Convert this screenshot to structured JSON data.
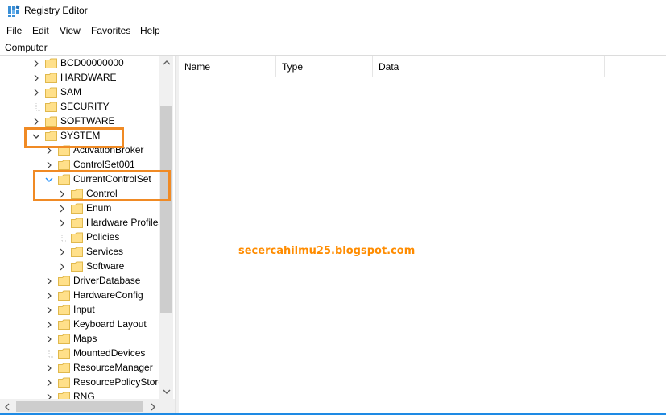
{
  "window": {
    "title": "Registry Editor"
  },
  "menu": [
    "File",
    "Edit",
    "View",
    "Favorites",
    "Help"
  ],
  "address": "Computer",
  "columns": [
    "Name",
    "Type",
    "Data"
  ],
  "tree": [
    {
      "label": "BCD00000000",
      "expander": "collapsed"
    },
    {
      "label": "HARDWARE",
      "expander": "collapsed"
    },
    {
      "label": "SAM",
      "expander": "collapsed"
    },
    {
      "label": "SECURITY",
      "expander": "none"
    },
    {
      "label": "SOFTWARE",
      "expander": "collapsed"
    },
    {
      "label": "SYSTEM",
      "expander": "expanded"
    },
    {
      "label": "ActivationBroker",
      "expander": "collapsed"
    },
    {
      "label": "ControlSet001",
      "expander": "collapsed"
    },
    {
      "label": "CurrentControlSet",
      "expander": "expanded-blue"
    },
    {
      "label": "Control",
      "expander": "collapsed"
    },
    {
      "label": "Enum",
      "expander": "collapsed"
    },
    {
      "label": "Hardware Profiles",
      "expander": "collapsed"
    },
    {
      "label": "Policies",
      "expander": "none"
    },
    {
      "label": "Services",
      "expander": "collapsed"
    },
    {
      "label": "Software",
      "expander": "collapsed"
    },
    {
      "label": "DriverDatabase",
      "expander": "collapsed"
    },
    {
      "label": "HardwareConfig",
      "expander": "collapsed"
    },
    {
      "label": "Input",
      "expander": "collapsed"
    },
    {
      "label": "Keyboard Layout",
      "expander": "collapsed"
    },
    {
      "label": "Maps",
      "expander": "collapsed"
    },
    {
      "label": "MountedDevices",
      "expander": "none"
    },
    {
      "label": "ResourceManager",
      "expander": "collapsed"
    },
    {
      "label": "ResourcePolicyStore",
      "expander": "collapsed"
    },
    {
      "label": "RNG",
      "expander": "collapsed"
    }
  ],
  "watermark": "secercahilmu25.blogspot.com",
  "colors": {
    "folder": "#ffe08a",
    "folder_edge": "#e0b84c",
    "highlight": "#f08a24",
    "watermark": "#ff8c00",
    "expander": "#404040",
    "expander_active": "#1e90ff"
  },
  "icons": {
    "app": "registry-editor-icon",
    "folder": "folder-icon",
    "expand": "chevron-right-icon",
    "collapse": "chevron-down-icon",
    "scroll_up": "chevron-up-icon",
    "scroll_down": "chevron-down-icon",
    "scroll_left": "chevron-left-icon",
    "scroll_right": "chevron-right-icon"
  }
}
